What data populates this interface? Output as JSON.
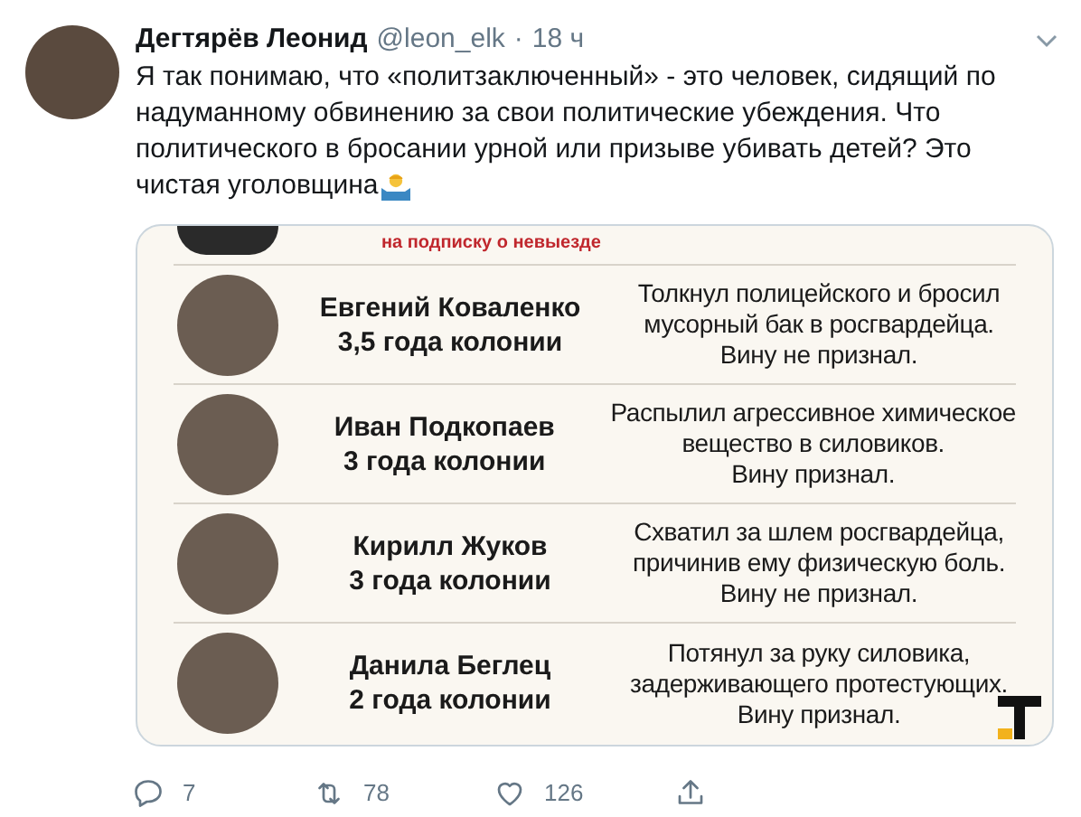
{
  "tweet": {
    "author": "Дегтярёв Леонид",
    "handle": "@leon_elk",
    "separator": "·",
    "time": "18 ч",
    "text_lines": [
      "Я так понимаю, что «политзаключенный» - это человек, сидящий по",
      "надуманному обвинению за свои политические убеждения. Что",
      "политического в бросании урной или призыве убивать детей? Это",
      "чистая уголовщина"
    ]
  },
  "infographic": {
    "cut_row_note": "на подписку о невыезде",
    "rows": [
      {
        "name": "Евгений Коваленко",
        "sentence": "3,5 года колонии",
        "description": [
          "Толкнул полицейского и бросил",
          "мусорный бак в росгвардейца.",
          "Вину не признал."
        ]
      },
      {
        "name": "Иван Подкопаев",
        "sentence": "3 года колонии",
        "description": [
          "Распылил агрессивное химическое",
          "вещество в силовиков.",
          "Вину признал."
        ]
      },
      {
        "name": "Кирилл Жуков",
        "sentence": "3 года колонии",
        "description": [
          "Схватил за шлем росгвардейца,",
          "причинив ему физическую боль.",
          "Вину не признал."
        ]
      },
      {
        "name": "Данила Беглец",
        "sentence": "2 года колонии",
        "description": [
          "Потянул за руку силовика,",
          "задерживающего протестующих.",
          "Вину признал."
        ]
      }
    ]
  },
  "actions": [
    {
      "kind": "reply",
      "count": "7"
    },
    {
      "kind": "retweet",
      "count": "78"
    },
    {
      "kind": "like",
      "count": "126"
    },
    {
      "kind": "share"
    }
  ]
}
